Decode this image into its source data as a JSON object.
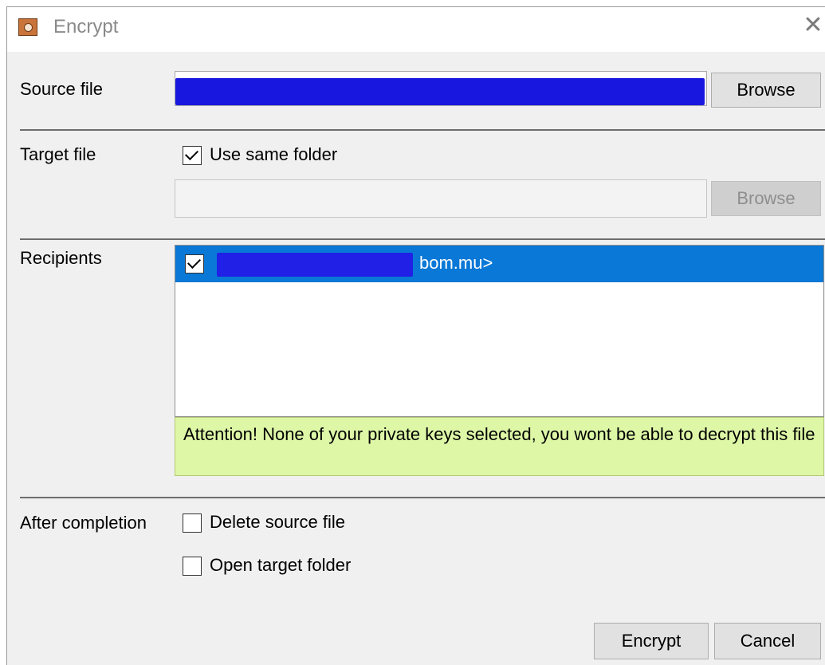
{
  "window": {
    "title": "Encrypt",
    "icon": "safe-icon",
    "close_icon": "close-icon"
  },
  "source": {
    "label": "Source file",
    "browse_label": "Browse"
  },
  "target": {
    "label": "Target file",
    "use_same_folder_label": "Use same folder",
    "use_same_folder_checked": true,
    "path_value": "",
    "browse_label": "Browse"
  },
  "recipients": {
    "label": "Recipients",
    "items": [
      {
        "text": "bom.mu>",
        "checked": true,
        "selected": true
      }
    ],
    "attention": "Attention! None of your private keys selected, you wont be able to decrypt this file"
  },
  "after": {
    "label": "After completion",
    "delete_source_label": "Delete source file",
    "delete_source_checked": false,
    "open_folder_label": "Open target folder",
    "open_folder_checked": false
  },
  "footer": {
    "encrypt_label": "Encrypt",
    "cancel_label": "Cancel"
  },
  "colors": {
    "selection": "#0a78d6",
    "attention_bg": "#ddf7a7",
    "redaction": "#1717e0"
  }
}
